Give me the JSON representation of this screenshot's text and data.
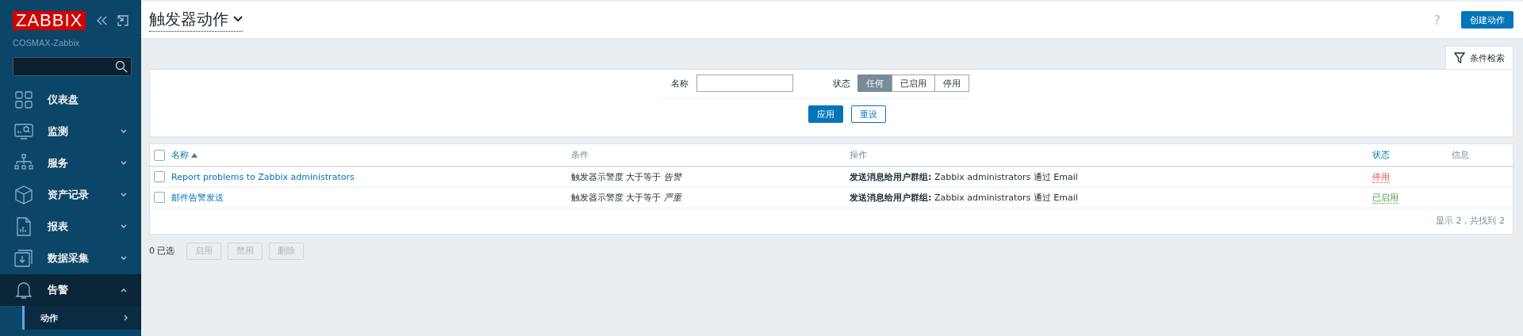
{
  "sidebar": {
    "logo": "ZABBIX",
    "server": "COSMAX-Zabbix",
    "items": [
      {
        "label": "仪表盘",
        "expandable": false,
        "expanded": false
      },
      {
        "label": "监测",
        "expandable": true,
        "expanded": false
      },
      {
        "label": "服务",
        "expandable": true,
        "expanded": false
      },
      {
        "label": "资产记录",
        "expandable": true,
        "expanded": false
      },
      {
        "label": "报表",
        "expandable": true,
        "expanded": false
      },
      {
        "label": "数据采集",
        "expandable": true,
        "expanded": false
      },
      {
        "label": "告警",
        "expandable": true,
        "expanded": true,
        "children": [
          {
            "label": "动作",
            "selected": true
          }
        ]
      }
    ]
  },
  "header": {
    "title": "触发器动作",
    "help": "?",
    "create_button": "创建动作"
  },
  "filter": {
    "tab": "条件检索",
    "name_label": "名称",
    "status_label": "状态",
    "status_options": [
      {
        "label": "任何",
        "selected": true
      },
      {
        "label": "已启用",
        "selected": false
      },
      {
        "label": "停用",
        "selected": false
      }
    ],
    "apply": "应用",
    "reset": "重设"
  },
  "table": {
    "select_all": {
      "checked": false
    },
    "columns": [
      {
        "label": "名称",
        "sortable": true,
        "sorted": true
      },
      {
        "label": "条件",
        "sortable": false,
        "sorted": false
      },
      {
        "label": "操作",
        "sortable": false,
        "sorted": false
      },
      {
        "label": "状态",
        "sortable": true,
        "sorted": false
      },
      {
        "label": "信息",
        "sortable": false,
        "sorted": false
      }
    ],
    "rows": [
      {
        "checked": false,
        "name": "Report problems to Zabbix administrators",
        "condition": "触发器示警度 大于等于 *告警*",
        "operation": "**发送消息给用户群组:** Zabbix administrators 通过 Email",
        "status": {
          "text": "停用",
          "kind": "disabled"
        }
      },
      {
        "checked": false,
        "name": "邮件告警发送",
        "condition": "触发器示警度 大于等于 *严重*",
        "operation": "**发送消息给用户群组:** Zabbix administrators 通过 Email",
        "status": {
          "text": "已启用",
          "kind": "enabled"
        }
      }
    ],
    "summary": "显示 2，共找到 2"
  },
  "footer": {
    "selected": "0 已选",
    "buttons": [
      {
        "label": "启用",
        "disabled": true
      },
      {
        "label": "禁用",
        "disabled": true
      },
      {
        "label": "删除",
        "disabled": true
      }
    ]
  }
}
